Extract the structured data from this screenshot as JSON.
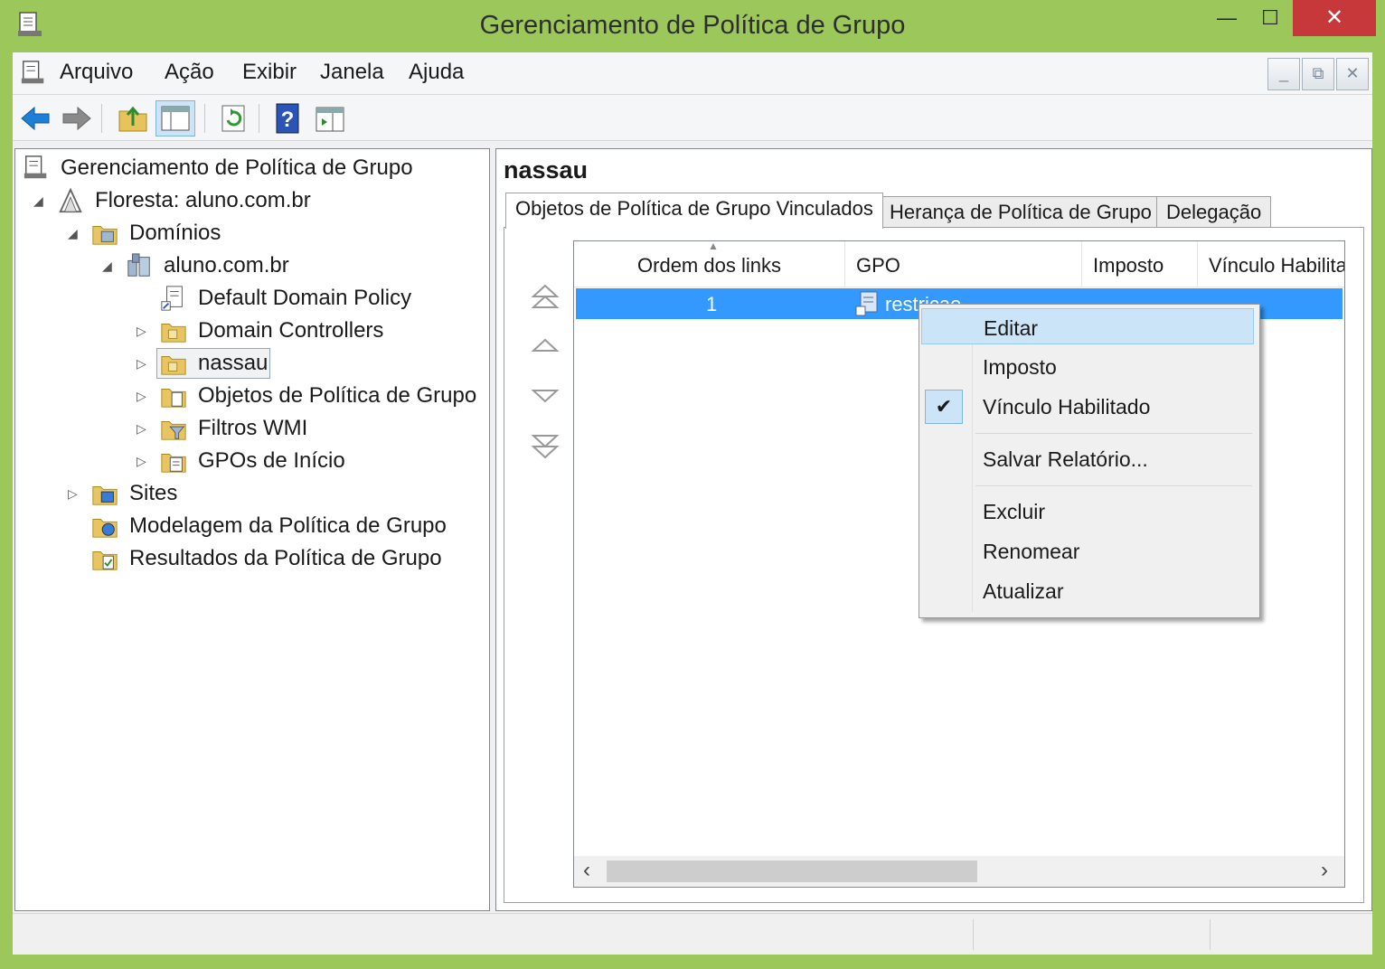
{
  "window": {
    "title": "Gerenciamento de Política de Grupo",
    "close_glyph": "✕",
    "max_glyph": "☐",
    "min_glyph": "—"
  },
  "menu": [
    "Arquivo",
    "Ação",
    "Exibir",
    "Janela",
    "Ajuda"
  ],
  "mdi": {
    "min": "_",
    "restore": "⧉",
    "close": "✕"
  },
  "tree": {
    "root": "Gerenciamento de Política de Grupo",
    "forest": "Floresta: aluno.com.br",
    "domains": "Domínios",
    "domain": "aluno.com.br",
    "items": [
      "Default Domain Policy",
      "Domain Controllers",
      "nassau",
      "Objetos de Política de Grupo",
      "Filtros WMI",
      "GPOs de Início"
    ],
    "sites": "Sites",
    "modeling": "Modelagem da Política de Grupo",
    "results": "Resultados da Política de Grupo"
  },
  "right": {
    "title": "nassau",
    "tabs": [
      "Objetos de Política de Grupo Vinculados",
      "Herança de Política de Grupo",
      "Delegação"
    ],
    "columns": [
      "Ordem dos links",
      "GPO",
      "Imposto",
      "Vínculo Habilita"
    ],
    "row": {
      "order": "1",
      "gpo": "restricao"
    }
  },
  "context_menu": {
    "items": [
      "Editar",
      "Imposto",
      "Vínculo Habilitado",
      "Salvar Relatório...",
      "Excluir",
      "Renomear",
      "Atualizar"
    ],
    "checked": "Vínculo Habilitado"
  },
  "colors": {
    "titlebar": "#9bc75b",
    "selection": "#3399ff",
    "close": "#c7383b"
  }
}
